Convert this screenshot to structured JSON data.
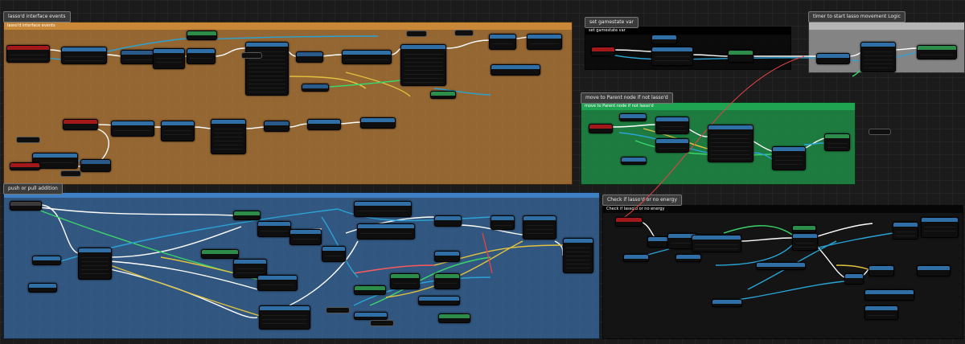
{
  "groups": {
    "lasso_interface": {
      "tab": "lasso'd interface events",
      "header": "lasso'd interface events",
      "color": "#b07838"
    },
    "push_or_pull": {
      "tab": "push or pull addition",
      "color": "#3a6fa8"
    },
    "set_gamestate": {
      "tab": "set gamestate var",
      "header": "set gamestate var",
      "color": "#0b0b0b"
    },
    "timer": {
      "tab": "timer to start lasso movement Logic",
      "color": "#9a9a9a"
    },
    "move_parent": {
      "tab": "move to Parent node if not lasso'd",
      "header": "move to Parent node if not lasso'd",
      "color": "#1d8f46"
    },
    "check_lasso": {
      "tab": "Check if lasso'd or no energy",
      "header": "Check if lasso'd or no energy",
      "color": "#141414"
    }
  }
}
